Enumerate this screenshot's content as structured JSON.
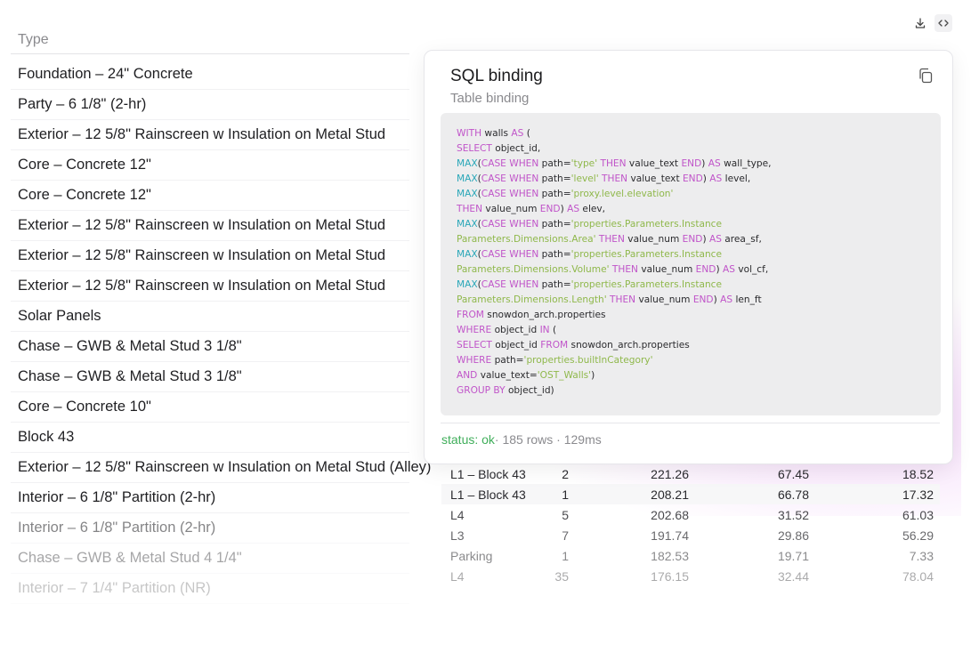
{
  "toolbar": {
    "download_icon": "download-icon",
    "code_icon": "code-icon"
  },
  "type_column": {
    "header": "Type",
    "rows": [
      "Foundation – 24\" Concrete",
      "Party – 6 1/8\" (2-hr)",
      "Exterior – 12 5/8\" Rainscreen w Insulation on Metal Stud",
      "Core – Concrete 12\"",
      "Core – Concrete 12\"",
      "Exterior – 12 5/8\" Rainscreen w Insulation on Metal Stud",
      "Exterior – 12 5/8\" Rainscreen w Insulation on Metal Stud",
      "Exterior – 12 5/8\" Rainscreen w Insulation on Metal Stud",
      "Solar Panels",
      "Chase – GWB & Metal Stud 3 1/8\"",
      "Chase – GWB & Metal Stud 3 1/8\"",
      "Core – Concrete 10\"",
      "Block 43",
      "Exterior – 12 5/8\" Rainscreen w Insulation on Metal Stud (Alley)",
      "Interior – 6 1/8\" Partition (2-hr)",
      "Interior – 6 1/8\" Partition (2-hr)",
      "Chase – GWB & Metal Stud 4 1/4\"",
      "Interior – 7 1/4\" Partition (NR)"
    ]
  },
  "data_table": {
    "rows": [
      {
        "level": "L1 – Block 43",
        "count": "2",
        "area": "221.26",
        "volume": "67.45",
        "length": "18.52"
      },
      {
        "level": "L1 – Block 43",
        "count": "1",
        "area": "208.21",
        "volume": "66.78",
        "length": "17.32"
      },
      {
        "level": "L4",
        "count": "5",
        "area": "202.68",
        "volume": "31.52",
        "length": "61.03"
      },
      {
        "level": "L3",
        "count": "7",
        "area": "191.74",
        "volume": "29.86",
        "length": "56.29"
      },
      {
        "level": "Parking",
        "count": "1",
        "area": "182.53",
        "volume": "19.71",
        "length": "7.33"
      },
      {
        "level": "L4",
        "count": "35",
        "area": "176.15",
        "volume": "32.44",
        "length": "78.04"
      }
    ]
  },
  "sql_card": {
    "title": "SQL binding",
    "subtitle": "Table binding",
    "copy_icon": "copy-icon",
    "code_lines": [
      [
        {
          "t": "WITH",
          "c": "kw"
        },
        {
          "t": " walls "
        },
        {
          "t": "AS",
          "c": "kw"
        },
        {
          "t": " ("
        }
      ],
      [
        {
          "t": "SELECT",
          "c": "kw"
        },
        {
          "t": " object_id,"
        }
      ],
      [
        {
          "t": "MAX",
          "c": "fn"
        },
        {
          "t": "("
        },
        {
          "t": "CASE WHEN",
          "c": "kw"
        },
        {
          "t": " path="
        },
        {
          "t": "'type'",
          "c": "str"
        },
        {
          "t": " "
        },
        {
          "t": "THEN",
          "c": "kw"
        },
        {
          "t": " value_text "
        },
        {
          "t": "END",
          "c": "kw"
        },
        {
          "t": ") "
        },
        {
          "t": "AS",
          "c": "kw"
        },
        {
          "t": " wall_type,"
        }
      ],
      [
        {
          "t": "MAX",
          "c": "fn"
        },
        {
          "t": "("
        },
        {
          "t": "CASE WHEN",
          "c": "kw"
        },
        {
          "t": " path="
        },
        {
          "t": "'level'",
          "c": "str"
        },
        {
          "t": " "
        },
        {
          "t": "THEN",
          "c": "kw"
        },
        {
          "t": " value_text "
        },
        {
          "t": "END",
          "c": "kw"
        },
        {
          "t": ") "
        },
        {
          "t": "AS",
          "c": "kw"
        },
        {
          "t": " level,"
        }
      ],
      [
        {
          "t": "MAX",
          "c": "fn"
        },
        {
          "t": "("
        },
        {
          "t": "CASE WHEN",
          "c": "kw"
        },
        {
          "t": " path="
        },
        {
          "t": "'proxy.level.elevation'",
          "c": "str"
        }
      ],
      [
        {
          "t": "THEN",
          "c": "kw"
        },
        {
          "t": " value_num "
        },
        {
          "t": "END",
          "c": "kw"
        },
        {
          "t": ") "
        },
        {
          "t": "AS",
          "c": "kw"
        },
        {
          "t": " elev,"
        }
      ],
      [
        {
          "t": "MAX",
          "c": "fn"
        },
        {
          "t": "("
        },
        {
          "t": "CASE WHEN",
          "c": "kw"
        },
        {
          "t": " path="
        },
        {
          "t": "'properties.Parameters.Instance",
          "c": "str"
        }
      ],
      [
        {
          "t": "Parameters.Dimensions.Area'",
          "c": "str"
        },
        {
          "t": " "
        },
        {
          "t": "THEN",
          "c": "kw"
        },
        {
          "t": " value_num "
        },
        {
          "t": "END",
          "c": "kw"
        },
        {
          "t": ") "
        },
        {
          "t": "AS",
          "c": "kw"
        },
        {
          "t": " area_sf,"
        }
      ],
      [
        {
          "t": "MAX",
          "c": "fn"
        },
        {
          "t": "("
        },
        {
          "t": "CASE WHEN",
          "c": "kw"
        },
        {
          "t": " path="
        },
        {
          "t": "'properties.Parameters.Instance",
          "c": "str"
        }
      ],
      [
        {
          "t": "Parameters.Dimensions.Volume'",
          "c": "str"
        },
        {
          "t": " "
        },
        {
          "t": "THEN",
          "c": "kw"
        },
        {
          "t": " value_num "
        },
        {
          "t": "END",
          "c": "kw"
        },
        {
          "t": ") "
        },
        {
          "t": "AS",
          "c": "kw"
        },
        {
          "t": " vol_cf,"
        }
      ],
      [
        {
          "t": "MAX",
          "c": "fn"
        },
        {
          "t": "("
        },
        {
          "t": "CASE WHEN",
          "c": "kw"
        },
        {
          "t": " path="
        },
        {
          "t": "'properties.Parameters.Instance",
          "c": "str"
        }
      ],
      [
        {
          "t": "Parameters.Dimensions.Length'",
          "c": "str"
        },
        {
          "t": " "
        },
        {
          "t": "THEN",
          "c": "kw"
        },
        {
          "t": " value_num "
        },
        {
          "t": "END",
          "c": "kw"
        },
        {
          "t": ") "
        },
        {
          "t": "AS",
          "c": "kw"
        },
        {
          "t": " len_ft"
        }
      ],
      [
        {
          "t": "FROM",
          "c": "kw"
        },
        {
          "t": " snowdon_arch.properties"
        }
      ],
      [
        {
          "t": "WHERE",
          "c": "kw"
        },
        {
          "t": " object_id "
        },
        {
          "t": "IN",
          "c": "kw"
        },
        {
          "t": " ("
        }
      ],
      [
        {
          "t": "SELECT",
          "c": "kw"
        },
        {
          "t": " object_id "
        },
        {
          "t": "FROM",
          "c": "kw"
        },
        {
          "t": " snowdon_arch.properties"
        }
      ],
      [
        {
          "t": "WHERE",
          "c": "kw"
        },
        {
          "t": " path="
        },
        {
          "t": "'properties.builtInCategory'",
          "c": "str"
        }
      ],
      [
        {
          "t": "AND",
          "c": "kw"
        },
        {
          "t": " value_text="
        },
        {
          "t": "'OST_Walls'",
          "c": "str"
        },
        {
          "t": ")"
        }
      ],
      [
        {
          "t": "GROUP BY",
          "c": "kw"
        },
        {
          "t": " object_id)"
        }
      ]
    ],
    "status_label": "status: ok",
    "status_rest": "· 185 rows · 129ms"
  },
  "colors": {
    "keyword": "#c054c9",
    "function": "#2aa7b8",
    "string": "#8fb84b",
    "status_ok": "#3fae5a"
  }
}
